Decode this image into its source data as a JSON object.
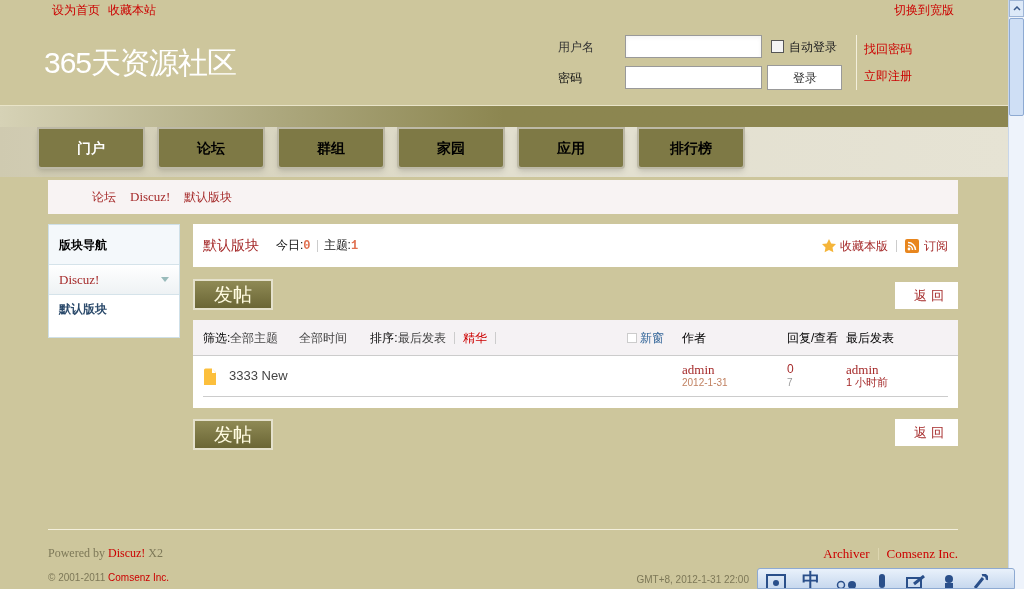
{
  "top_links": [
    "设为首页",
    "收藏本站"
  ],
  "switch_link": "切换到宽版",
  "logo": "365天资源社区",
  "login": {
    "username_label": "用户名",
    "password_label": "密码",
    "auto_login": {
      "label": "自动登录",
      "checked": false
    },
    "login_button": "登录",
    "forgot_link": "找回密码",
    "register_link": "立即注册"
  },
  "nav_tabs": [
    {
      "label": "门户",
      "selected": true
    },
    {
      "label": "论坛",
      "selected": false
    },
    {
      "label": "群组",
      "selected": false
    },
    {
      "label": "家园",
      "selected": false
    },
    {
      "label": "应用",
      "selected": false
    },
    {
      "label": "排行榜",
      "selected": false
    }
  ],
  "breadcrumb": [
    "论坛",
    "Discuz!",
    "默认版块"
  ],
  "sidebar": {
    "title": "版块导航",
    "items": [
      {
        "label": "Discuz!",
        "kind": "group"
      },
      {
        "label": "默认版块",
        "kind": "forum"
      }
    ]
  },
  "forum_header": {
    "title": "默认版块",
    "today_label": "今日:",
    "today": "0",
    "topics_label": "主题:",
    "topics": "1",
    "favorite": "收藏本版",
    "subscribe": "订阅"
  },
  "post_buttons": [
    "发帖",
    "发帖"
  ],
  "back_buttons": [
    "返 回",
    "返 回"
  ],
  "thread_list": {
    "filter_label": "筛选:",
    "filter_topics": "全部主题",
    "filter_time": "全部时间",
    "sort_label": "排序:",
    "sort_value": "最后发表",
    "digest": "精华",
    "new_window": {
      "label": "新窗",
      "checked": false
    },
    "columns": [
      "作者",
      "回复/查看",
      "最后发表"
    ],
    "rows": [
      {
        "title": "3333 New",
        "author": "admin",
        "date": "2012-1-31",
        "replies": "0",
        "views": "7",
        "last_user": "admin",
        "last_time": "1 小时前"
      }
    ]
  },
  "footer": {
    "powered": "Powered by ",
    "brand": "Discuz!",
    "version": " X2",
    "copyright": "© 2001-2011 ",
    "company": "Comsenz Inc.",
    "links": [
      "Archiver",
      "Comsenz Inc."
    ],
    "time": "GMT+8, 2012-1-31 22:00"
  },
  "ime_toolbar": {
    "label": "中"
  }
}
